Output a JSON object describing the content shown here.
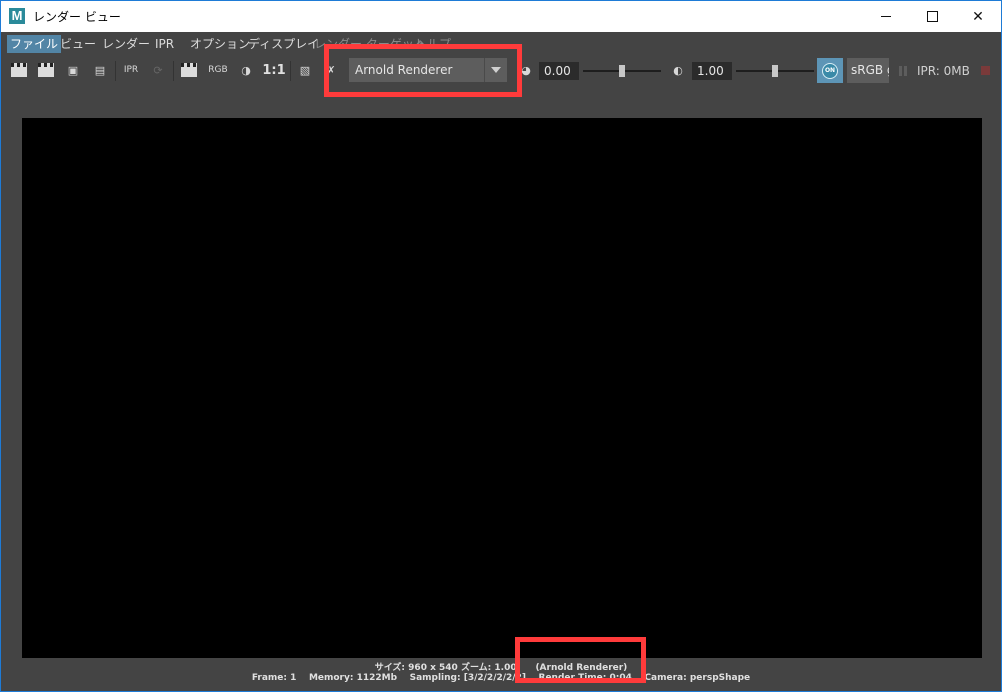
{
  "window": {
    "title": "レンダー ビュー",
    "app_icon_letter": "M"
  },
  "menu": {
    "items": [
      "ファイル",
      "ビュー",
      "レンダー",
      "IPR",
      "オプション",
      "ディスプレイ",
      "レンダー ターゲット",
      "ヘルプ"
    ]
  },
  "toolbar": {
    "rgb_label": "RGB",
    "ratio_label": "1:1",
    "renderer": "Arnold Renderer",
    "exposure": "0.00",
    "gamma": "1.00",
    "on_label": "ON",
    "colorspace": "sRGB g",
    "ipr_memory": "IPR: 0MB"
  },
  "status": {
    "line1_size": "サイズ: 960 x 540",
    "line1_zoom": "ズーム: 1.00",
    "line1_renderer": "(Arnold Renderer)",
    "line2_frame": "Frame: 1",
    "line2_memory": "Memory: 1122Mb",
    "line2_sampling": "Sampling: [3/2/2/2/2/2]",
    "line2_render_time": "Render Time: 0:04",
    "line2_camera": "Camera: perspShape"
  },
  "colors": {
    "highlight": "#ff3b3b",
    "menu_active": "#5285a6",
    "background": "#444444"
  }
}
